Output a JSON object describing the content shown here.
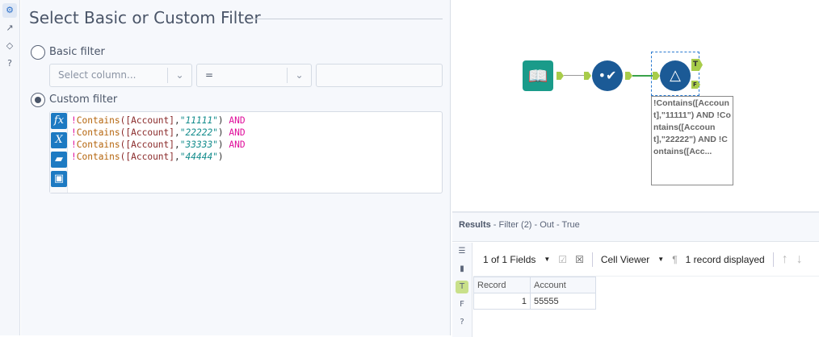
{
  "config": {
    "title": "Select Basic or Custom Filter",
    "basic": {
      "label": "Basic filter",
      "column_placeholder": "Select column...",
      "operator": "=",
      "value": ""
    },
    "custom": {
      "label": "Custom filter",
      "lines": [
        {
          "bang": "!",
          "fn": "Contains",
          "open": "(",
          "field": "[Account]",
          "comma": ",",
          "str": "\"11111\"",
          "close": ")",
          "op": " AND"
        },
        {
          "bang": "!",
          "fn": "Contains",
          "open": "(",
          "field": "[Account]",
          "comma": ",",
          "str": "\"22222\"",
          "close": ")",
          "op": " AND"
        },
        {
          "bang": "!",
          "fn": "Contains",
          "open": "(",
          "field": "[Account]",
          "comma": ",",
          "str": "\"33333\"",
          "close": ")",
          "op": " AND"
        },
        {
          "bang": "!",
          "fn": "Contains",
          "open": "(",
          "field": "[Account]",
          "comma": ",",
          "str": "\"44444\"",
          "close": ")",
          "op": ""
        }
      ]
    }
  },
  "canvas": {
    "annotation": "!Contains([Account],\"11111\") AND !Contains([Account],\"22222\") AND !Contains([Acc...",
    "anchor_true": "T",
    "anchor_false": "F"
  },
  "results": {
    "title": "Results",
    "subtitle": " - Filter (2) - Out - True",
    "fields": "1 of 1 Fields",
    "viewer": "Cell Viewer",
    "records": "1 record displayed",
    "columns": [
      "Record",
      "Account"
    ],
    "rows": [
      [
        "1",
        "55555"
      ]
    ]
  }
}
